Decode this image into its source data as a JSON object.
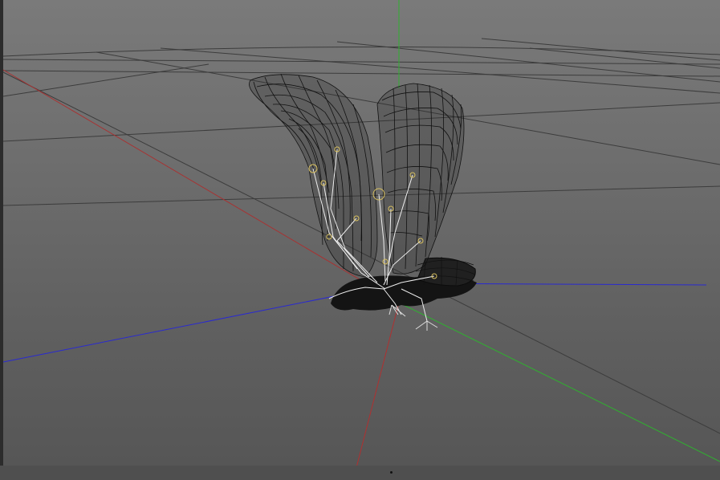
{
  "viewport": {
    "mode": "perspective",
    "grid_visible": true,
    "axis_colors": {
      "x": "#b03030",
      "y": "#2fb02f",
      "z": "#2a2ad0"
    },
    "mesh_color": "#111111",
    "rig_color": "#eeeeee",
    "joint_color": "#d8c060",
    "object": "bird-rig-wireframe"
  }
}
